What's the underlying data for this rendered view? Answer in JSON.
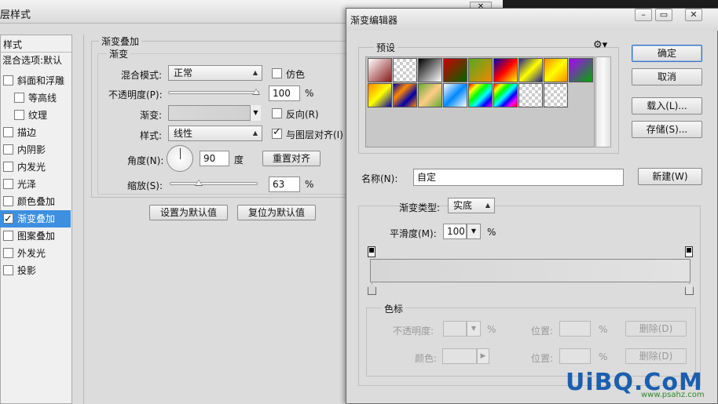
{
  "layer_style": {
    "window_title": "层样式",
    "sidebar_header": "样式",
    "blend_options": "混合选项:默认",
    "items": [
      {
        "label": "斜面和浮雕",
        "checked": false
      },
      {
        "label": "等高线",
        "checked": false
      },
      {
        "label": "纹理",
        "checked": false
      },
      {
        "label": "描边",
        "checked": false
      },
      {
        "label": "内阴影",
        "checked": false
      },
      {
        "label": "内发光",
        "checked": false
      },
      {
        "label": "光泽",
        "checked": false
      },
      {
        "label": "颜色叠加",
        "checked": false
      },
      {
        "label": "渐变叠加",
        "checked": true
      },
      {
        "label": "图案叠加",
        "checked": false
      },
      {
        "label": "外发光",
        "checked": false
      },
      {
        "label": "投影",
        "checked": false
      }
    ],
    "section_title": "渐变叠加",
    "group_title": "渐变",
    "blend_mode_label": "混合模式:",
    "blend_mode_value": "正常",
    "dither_label": "仿色",
    "opacity_label": "不透明度(P):",
    "opacity_value": "100",
    "opacity_unit": "%",
    "opacity_level": 1.0,
    "gradient_label": "渐变:",
    "reverse_label": "反向(R)",
    "style_label": "样式:",
    "style_value": "线性",
    "align_label": "与图层对齐(I)",
    "angle_label": "角度(N):",
    "angle_value": "90",
    "angle_unit": "度",
    "reset_align_button": "重置对齐",
    "scale_label": "缩放(S):",
    "scale_value": "63",
    "scale_unit": "%",
    "set_default_button": "设置为默认值",
    "reset_default_button": "复位为默认值"
  },
  "gradient_editor": {
    "title": "渐变编辑器",
    "presets_label": "预设",
    "ok_button": "确定",
    "cancel_button": "取消",
    "load_button": "载入(L)...",
    "save_button": "存储(S)...",
    "name_label": "名称(N):",
    "name_value": "自定",
    "new_button": "新建(W)",
    "gradient_type_label": "渐变类型:",
    "gradient_type_value": "实底",
    "smoothness_label": "平滑度(M):",
    "smoothness_value": "100",
    "smoothness_unit": "%",
    "stops_group": "色标",
    "stop_opacity_label": "不透明度:",
    "stop_opacity_unit": "%",
    "location_label": "位置:",
    "location_unit": "%",
    "delete_button": "删除(D)",
    "color_label": "颜色:",
    "location_label_2": "位置:",
    "location_unit_2": "%",
    "delete_button_2": "删除(D)"
  },
  "watermark": {
    "brand": "UiBQ.CoM",
    "site": "www.psahz.com"
  }
}
